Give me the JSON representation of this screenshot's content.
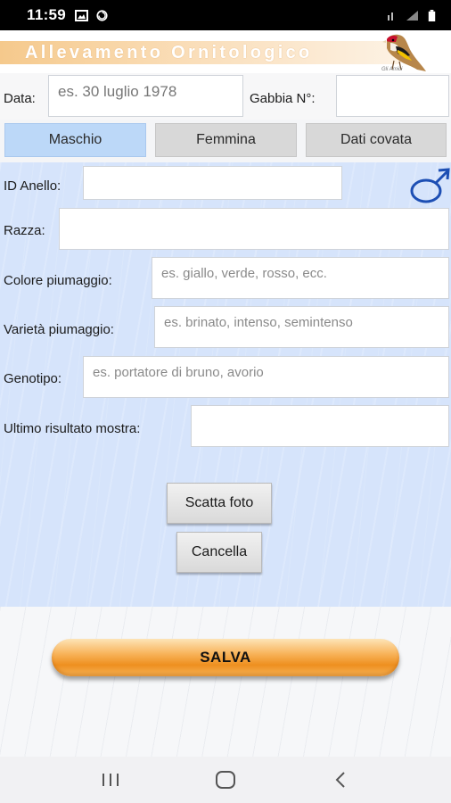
{
  "status_bar": {
    "time": "11:59",
    "icons": [
      "gallery-icon",
      "sync-icon",
      "wifi-icon",
      "signal-icon",
      "battery-icon"
    ]
  },
  "banner": {
    "title": "Allevamento Ornitologico",
    "logo_icon": "goldfinch-bird-icon",
    "logo_caption": "Gli Amici"
  },
  "form_top": {
    "date_label": "Data:",
    "date_placeholder": "es. 30 luglio 1978",
    "cage_label": "Gabbia N°:",
    "cage_value": ""
  },
  "tabs": [
    {
      "label": "Maschio",
      "active": true
    },
    {
      "label": "Femmina",
      "active": false
    },
    {
      "label": "Dati covata",
      "active": false
    }
  ],
  "male_form": {
    "gender_icon": "male-symbol-icon",
    "fields": {
      "ring_id": {
        "label": "ID Anello:",
        "value": "",
        "placeholder": ""
      },
      "breed": {
        "label": "Razza:",
        "value": "",
        "placeholder": ""
      },
      "plumage_color": {
        "label": "Colore piumaggio:",
        "placeholder": "es. giallo, verde, rosso, ecc."
      },
      "plumage_variety": {
        "label": "Varietà piumaggio:",
        "placeholder": "es. brinato, intenso, semintenso"
      },
      "genotype": {
        "label": "Genotipo:",
        "placeholder": "es. portatore di bruno, avorio"
      },
      "last_show_result": {
        "label": "Ultimo risultato mostra:",
        "value": "",
        "placeholder": ""
      }
    },
    "take_photo_button": "Scatta foto",
    "delete_button": "Cancella"
  },
  "save_button": "SALVA",
  "navigation_bar": {
    "buttons": [
      "recent-apps-icon",
      "home-icon",
      "back-icon"
    ]
  },
  "colors": {
    "active_tab": "#bcd8f8",
    "inactive_tab": "#d8d8d8",
    "form_panel": "#d6e4fb",
    "save_button": "#ee8f1f",
    "banner_strip": "#f5c98c",
    "male_symbol": "#1d4fb4"
  }
}
